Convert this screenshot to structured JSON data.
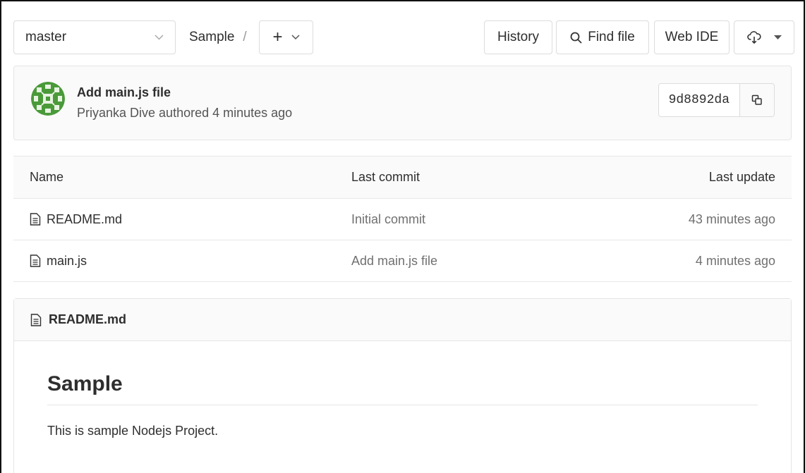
{
  "toolbar": {
    "branch": "master",
    "breadcrumb_project": "Sample",
    "breadcrumb_separator": "/",
    "add_label": "+",
    "history_label": "History",
    "find_file_label": "Find file",
    "web_ide_label": "Web IDE"
  },
  "commit": {
    "title": "Add main.js file",
    "meta": "Priyanka Dive authored 4 minutes ago",
    "sha": "9d8892da",
    "avatar_color": "#4a9a3a"
  },
  "table": {
    "headers": {
      "name": "Name",
      "last_commit": "Last commit",
      "last_update": "Last update"
    },
    "rows": [
      {
        "name": "README.md",
        "last_commit": "Initial commit",
        "last_update": "43 minutes ago",
        "icon": "file-text-icon"
      },
      {
        "name": "main.js",
        "last_commit": "Add main.js file",
        "last_update": "4 minutes ago",
        "icon": "file-text-icon"
      }
    ]
  },
  "readme": {
    "filename": "README.md",
    "heading": "Sample",
    "body": "This is sample Nodejs Project."
  }
}
